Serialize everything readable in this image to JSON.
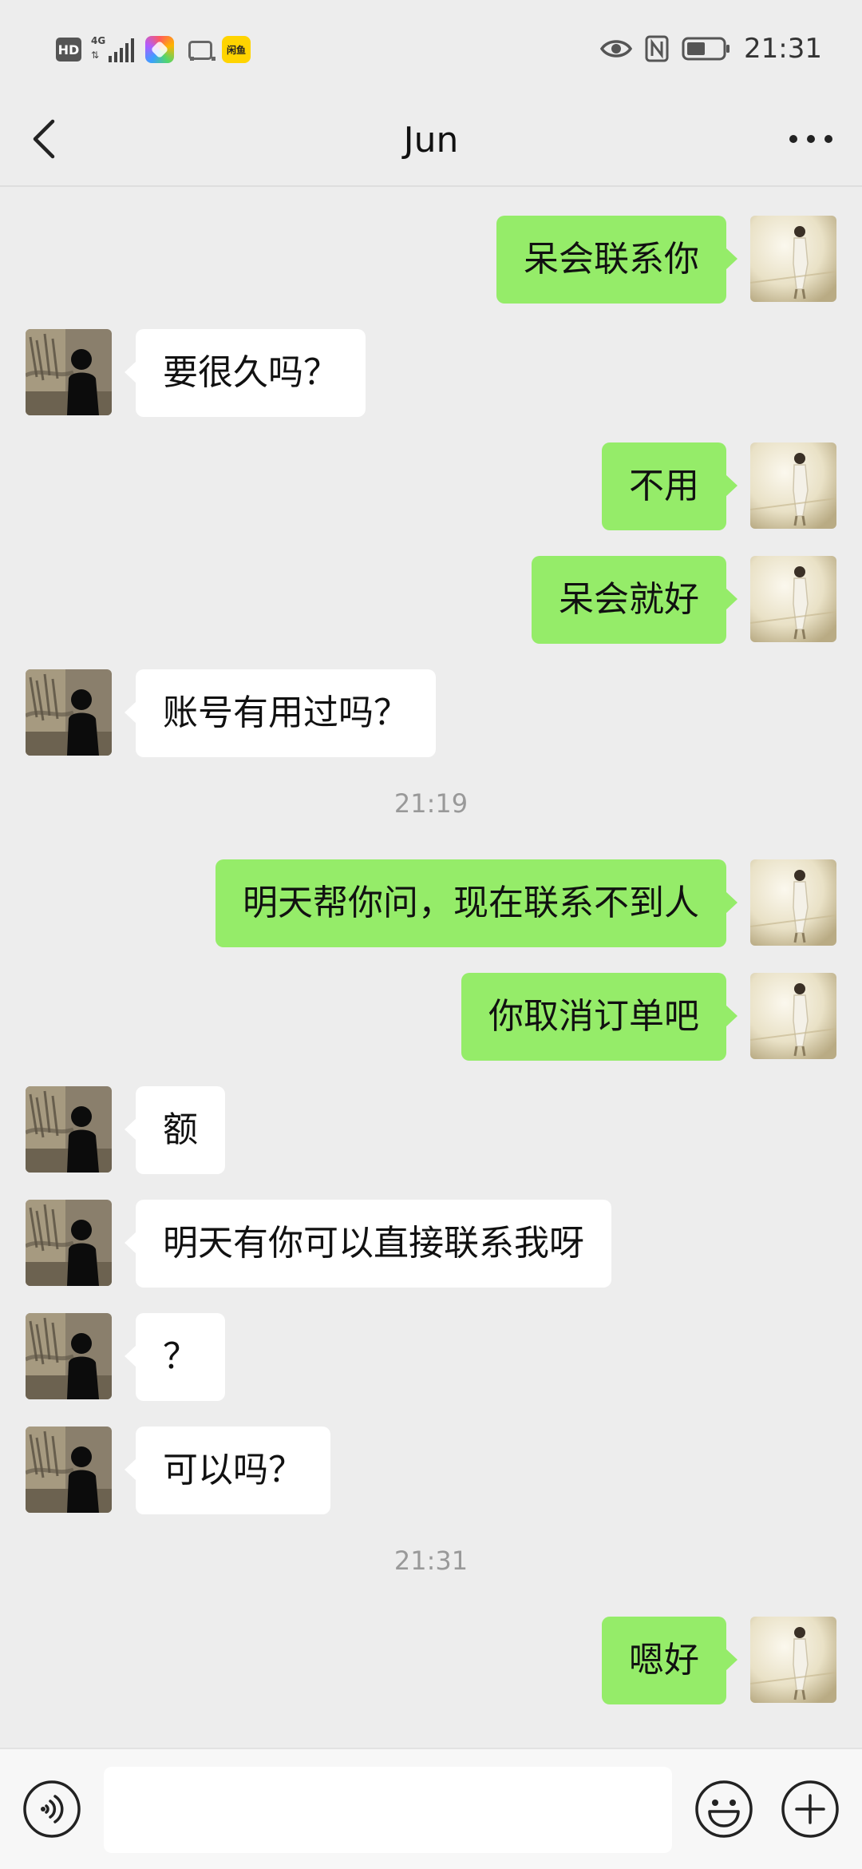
{
  "status_bar": {
    "network_label": "4G",
    "hd_label": "HD",
    "xianyu_label": "闲鱼",
    "time": "21:31"
  },
  "header": {
    "title": "Jun"
  },
  "messages": [
    {
      "type": "text",
      "direction": "out",
      "text": "呆会联系你"
    },
    {
      "type": "text",
      "direction": "in",
      "text": "要很久吗？"
    },
    {
      "type": "text",
      "direction": "out",
      "text": "不用"
    },
    {
      "type": "text",
      "direction": "out",
      "text": "呆会就好"
    },
    {
      "type": "text",
      "direction": "in",
      "text": "账号有用过吗？"
    },
    {
      "type": "time",
      "text": "21:19"
    },
    {
      "type": "text",
      "direction": "out",
      "text": "明天帮你问，现在联系不到人"
    },
    {
      "type": "text",
      "direction": "out",
      "text": "你取消订单吧"
    },
    {
      "type": "text",
      "direction": "in",
      "text": "额"
    },
    {
      "type": "text",
      "direction": "in",
      "text": "明天有你可以直接联系我呀"
    },
    {
      "type": "text",
      "direction": "in",
      "text": "？"
    },
    {
      "type": "text",
      "direction": "in",
      "text": "可以吗？"
    },
    {
      "type": "time",
      "text": "21:31"
    },
    {
      "type": "text",
      "direction": "out",
      "text": "嗯好"
    }
  ],
  "input_bar": {
    "value": "",
    "placeholder": ""
  },
  "icons": {
    "back": "chevron-left-icon",
    "more": "more-dots-icon",
    "voice": "voice-icon",
    "emoji": "emoji-icon",
    "plus": "plus-icon",
    "eye": "eye-icon",
    "nfc": "nfc-icon",
    "battery": "battery-icon"
  },
  "colors": {
    "outgoing_bubble": "#95ec69",
    "incoming_bubble": "#ffffff",
    "background": "#ededed"
  }
}
